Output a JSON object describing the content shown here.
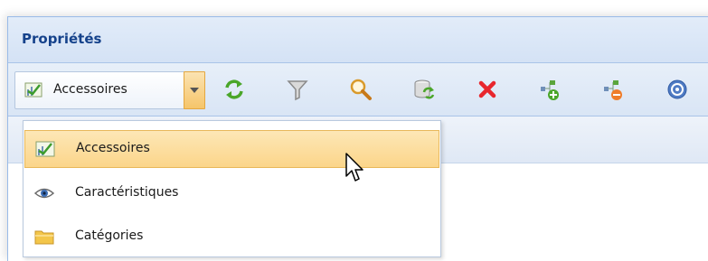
{
  "panel": {
    "title": "Propriétés"
  },
  "toolbar": {
    "combo": {
      "selected": "Accessoires",
      "icon": "chart-check-icon"
    },
    "buttons": [
      {
        "name": "refresh",
        "icon": "refresh-icon"
      },
      {
        "name": "filter",
        "icon": "filter-icon"
      },
      {
        "name": "search",
        "icon": "search-icon"
      },
      {
        "name": "database-refresh",
        "icon": "database-refresh-icon"
      },
      {
        "name": "delete",
        "icon": "close-icon"
      },
      {
        "name": "add-node",
        "icon": "tree-add-icon"
      },
      {
        "name": "remove-node",
        "icon": "tree-remove-icon"
      },
      {
        "name": "help",
        "icon": "help-icon"
      }
    ]
  },
  "dropdown": {
    "items": [
      {
        "label": "Accessoires",
        "icon": "chart-check-icon",
        "selected": true
      },
      {
        "label": "Caractéristiques",
        "icon": "eye-icon",
        "selected": false
      },
      {
        "label": "Catégories",
        "icon": "folder-icon",
        "selected": false
      }
    ]
  },
  "colors": {
    "header_title": "#15428b",
    "panel_border": "#99bbe8",
    "selection": "#fbd58a",
    "delete": "#e8262d",
    "refresh": "#4aa629"
  }
}
